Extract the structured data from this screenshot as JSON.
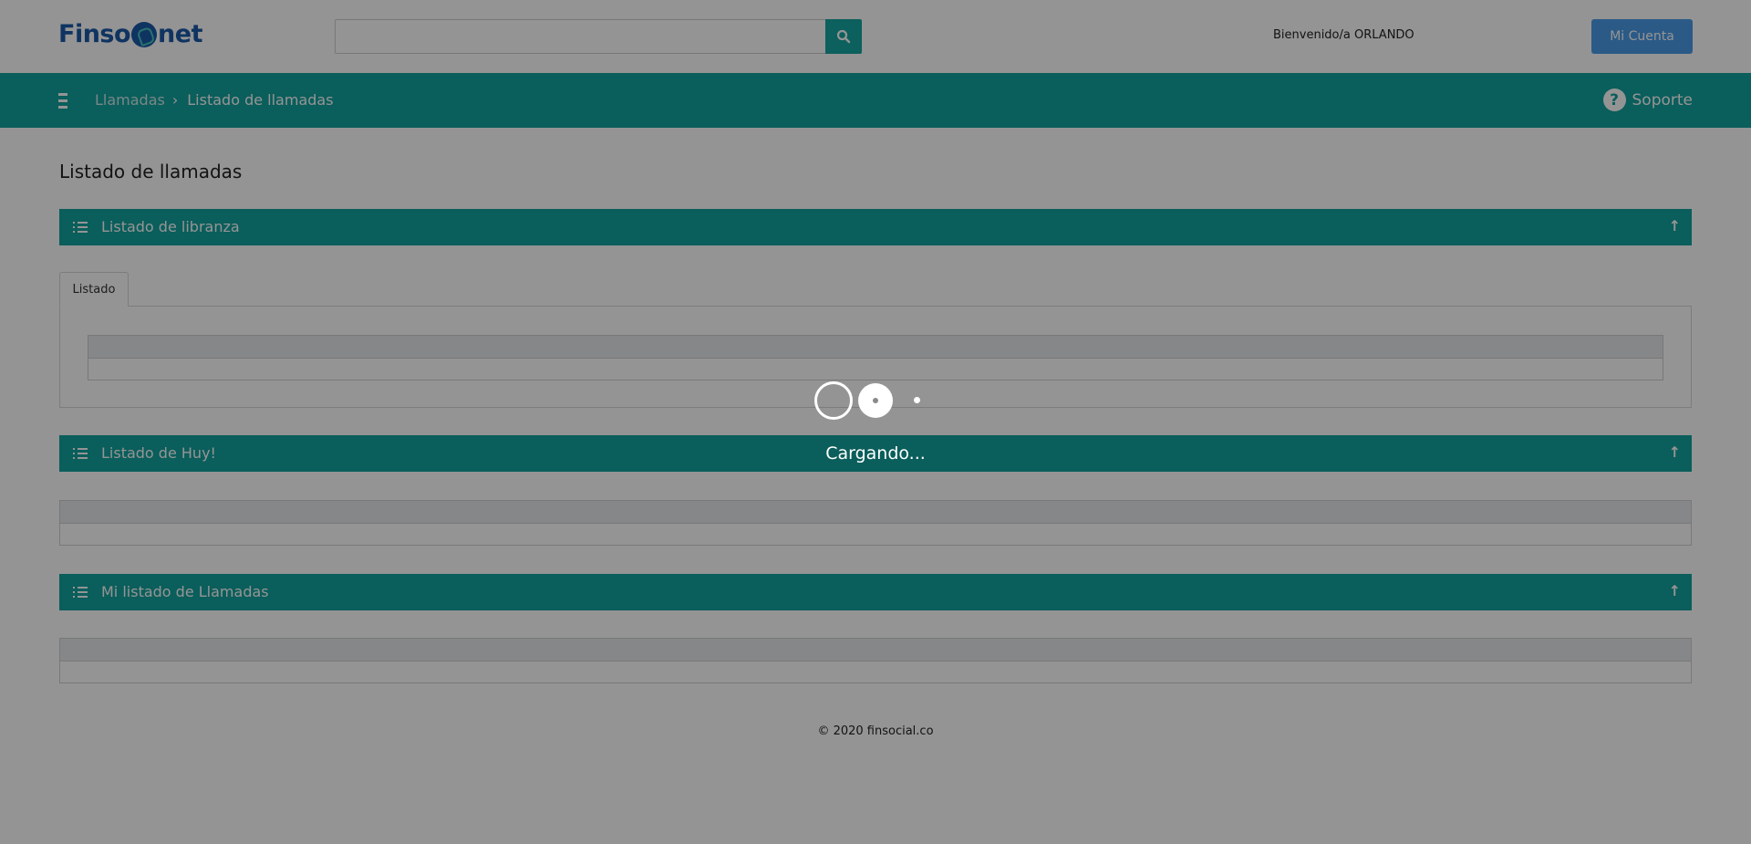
{
  "header": {
    "logo_left": "Finso",
    "logo_right": "net",
    "search": {
      "value": "",
      "placeholder": ""
    },
    "search_icon": "search-icon",
    "welcome": "Bienvenido/a ORLANDO",
    "account_button": "Mi Cuenta"
  },
  "navbar": {
    "menu_icon": "hamburger-icon",
    "breadcrumb": [
      {
        "label": "Llamadas"
      },
      {
        "label": "Listado de llamadas"
      }
    ],
    "support_label": "Soporte",
    "support_icon": "question-circle-icon"
  },
  "page": {
    "title": "Listado de llamadas",
    "sections": [
      {
        "title": "Listado de libranza",
        "tabs": [
          "Listado"
        ]
      },
      {
        "title": "Listado de Huy!"
      },
      {
        "title": "Mi listado de Llamadas"
      }
    ]
  },
  "footer": {
    "text": "© 2020 finsocial.co"
  },
  "overlay": {
    "loading_text": "Cargando..."
  },
  "colors": {
    "brand_teal": "#12a39e",
    "brand_blue": "#1a5aa8",
    "account_button": "#4a9ce8"
  }
}
